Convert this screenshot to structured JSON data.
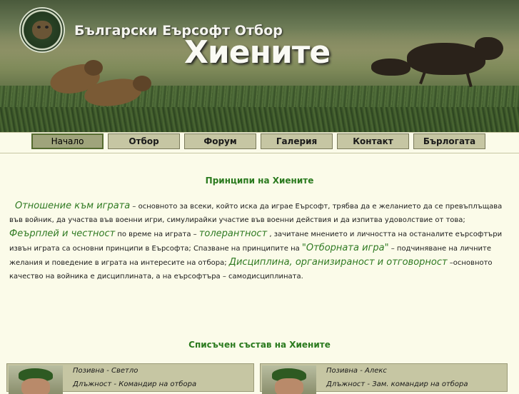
{
  "header": {
    "subtitle": "Български Еърсофт Отбор",
    "title": "Хиените",
    "logo_icon": "hyena-team-logo-icon"
  },
  "nav": {
    "items": [
      "Начало",
      "Отбор",
      "Форум",
      "Галерия",
      "Контакт",
      "Бърлогата"
    ],
    "active": "Начало"
  },
  "principles": {
    "title": "Принципи на Хиените",
    "p1_highlight": "Отношение към играта",
    "p1_text": " – основното за всеки, който иска да играе Еърсофт, трябва да е желанието да се превъплъщава във войник, да участва във военни игри, симулирайки участие във военни действия и да изпитва удоволствие от това; ",
    "p2_highlight": "Феърплей и честност",
    "p2_text": " по време на играта – ",
    "p3_highlight": "толерантност",
    "p3_text": " , зачитане мнението и личността на останалите еърсофтъри извън играта са основни принципи в Еърсофта; Спазване на принципите на ",
    "p4_highlight": "\"Отборната игра\"",
    "p4_text": " – подчиняване на личните желания и поведение в играта на интересите на отбора; ",
    "p5_highlight": "Дисциплина, организираност и отговорност",
    "p5_text": " –основното качество на войника е дисциплината, а на еърсофтъра – самодисциплината."
  },
  "roster": {
    "title": "Списъчен състав на Хиените",
    "members": [
      {
        "callsign": "Позивна - Светло",
        "role": "Длъжност - Командир на отбора"
      },
      {
        "callsign": "Позивна - Алекс",
        "role": "Длъжност - Зам. командир на отбора"
      }
    ]
  },
  "colors": {
    "background": "#fbfbe9",
    "nav_button": "#c6c6a3",
    "nav_active": "#9fa47b",
    "heading_green": "#2a7a1e"
  }
}
